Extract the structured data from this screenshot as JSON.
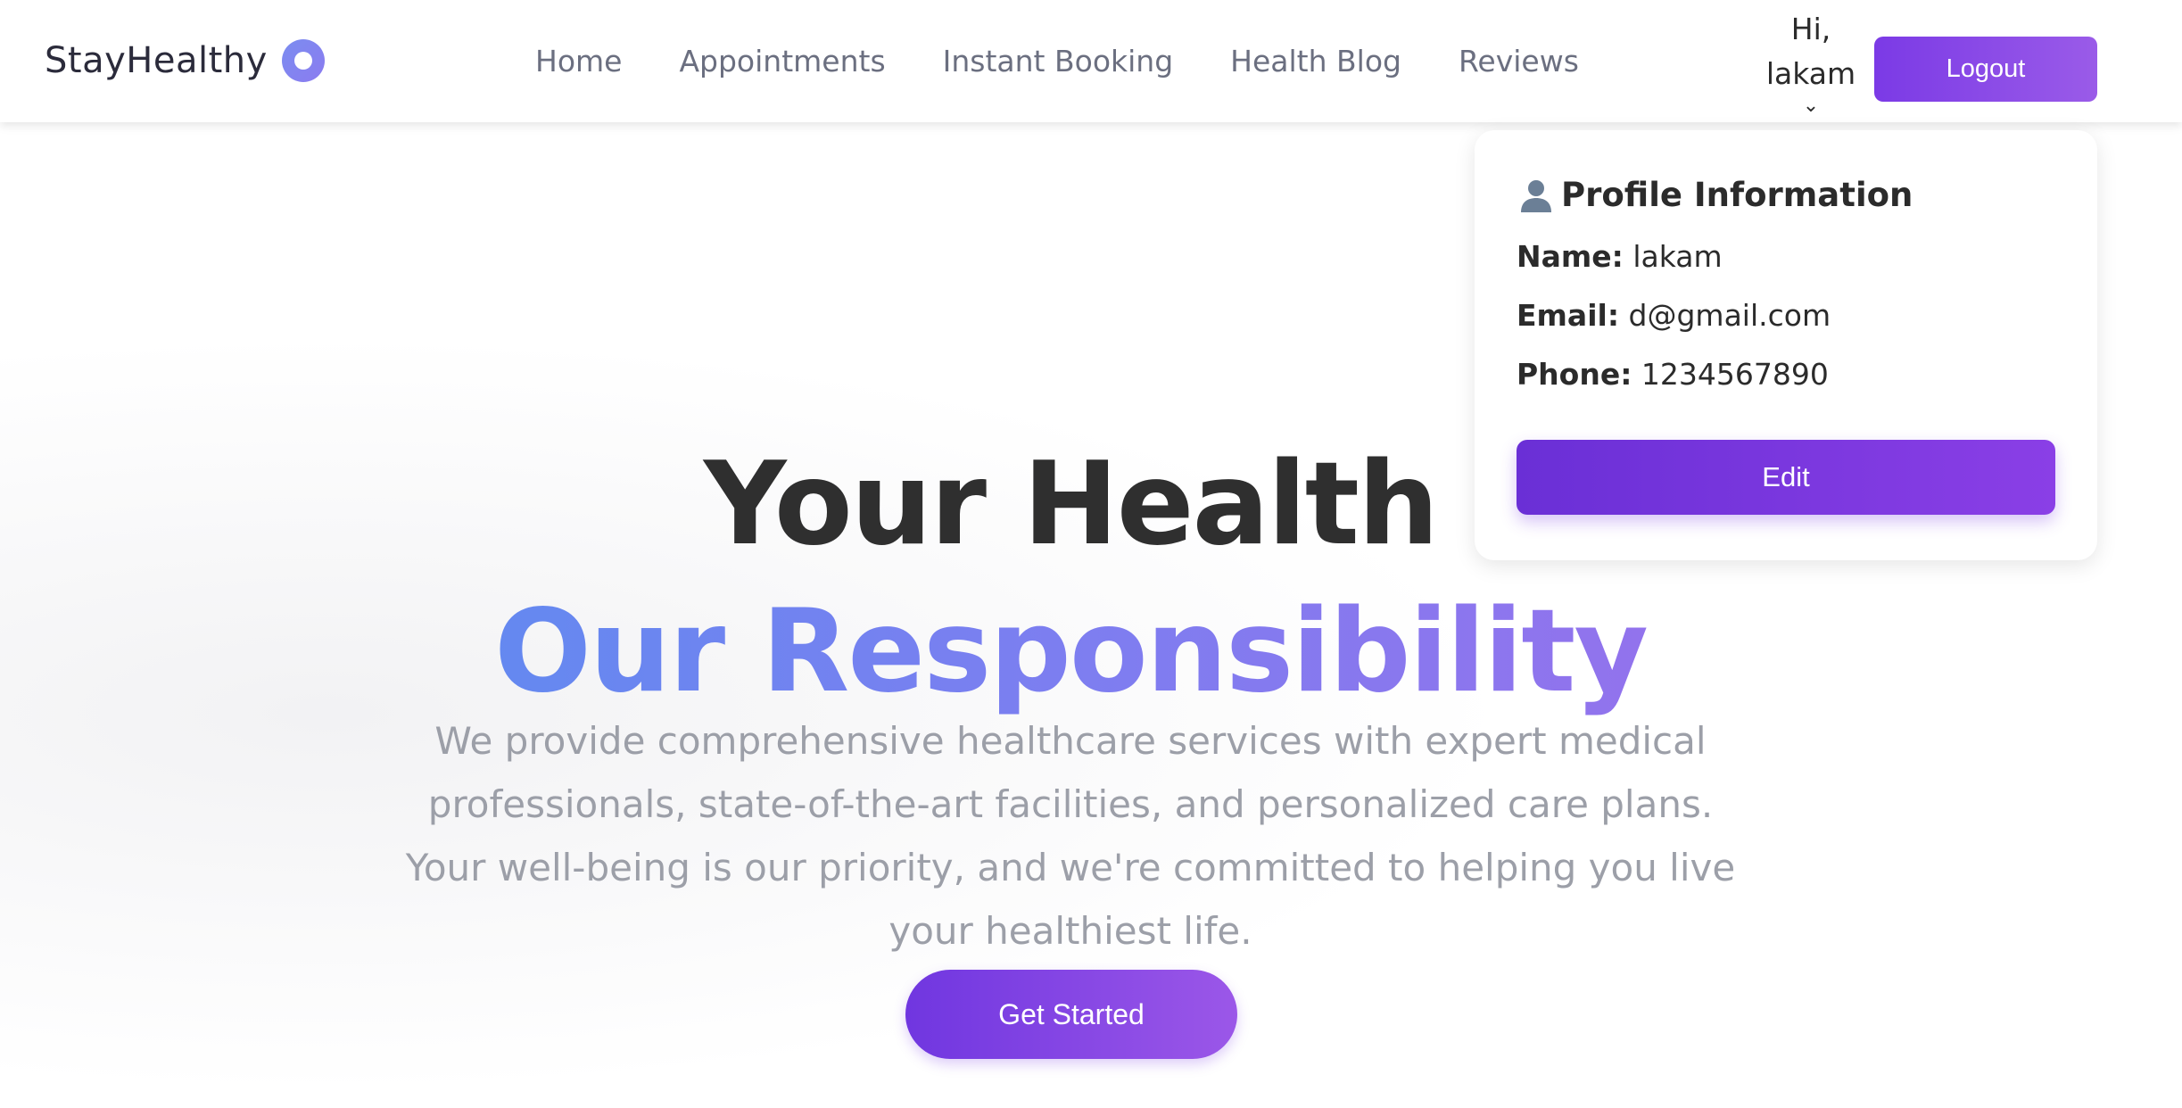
{
  "brand": {
    "name": "StayHealthy",
    "logo_icon": "ring-logo-icon",
    "accent": "#7b8df0"
  },
  "nav": {
    "links": [
      {
        "label": "Home"
      },
      {
        "label": "Appointments"
      },
      {
        "label": "Instant Booking"
      },
      {
        "label": "Health Blog"
      },
      {
        "label": "Reviews"
      }
    ]
  },
  "user": {
    "greeting": "Hi,",
    "username": "lakam",
    "caret": "⌄"
  },
  "logout": {
    "label": "Logout"
  },
  "hero": {
    "title_line1": "Your Health",
    "title_line2": "Our Responsibility",
    "subtitle": "We provide comprehensive healthcare services with expert medical professionals, state-of-the-art facilities, and personalized care plans. Your well-being is our priority, and we're committed to helping you live your healthiest life.",
    "cta_label": "Get Started"
  },
  "profile": {
    "icon": "user-icon",
    "heading": "Profile Information",
    "name_label": "Name:",
    "name_value": "lakam",
    "email_label": "Email:",
    "email_value": "d@gmail.com",
    "phone_label": "Phone:",
    "phone_value": "1234567890",
    "edit_label": "Edit"
  },
  "colors": {
    "primary_purple": "#7b3ae6",
    "gradient_blue": "#4f92f0",
    "gradient_purple": "#a469ea",
    "text_dark": "#2f2f2f",
    "text_muted": "#9c9fa8"
  }
}
